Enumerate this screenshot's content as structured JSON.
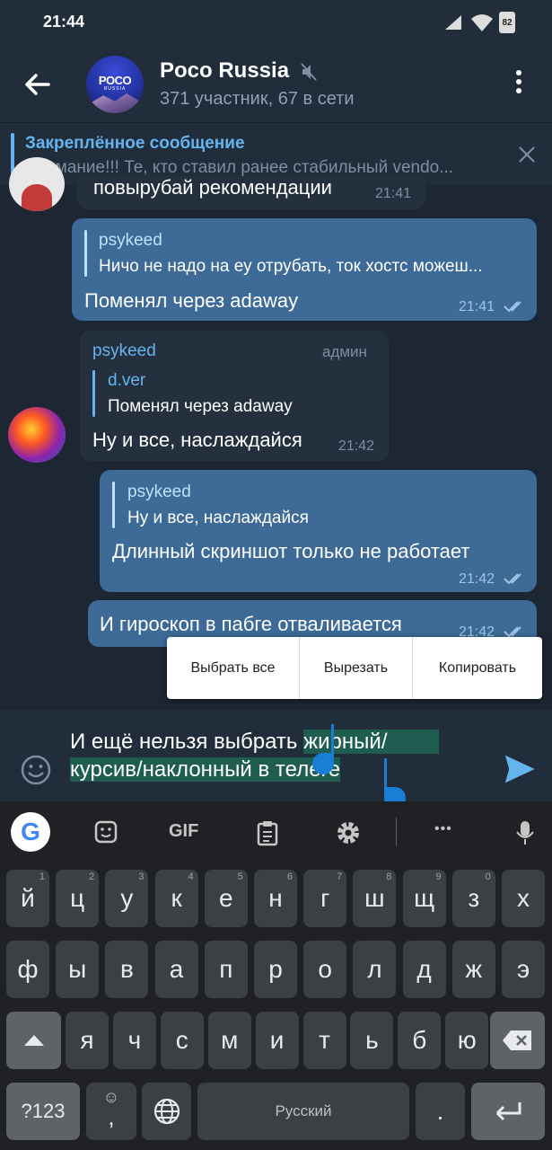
{
  "status": {
    "time": "21:44",
    "battery": "82"
  },
  "header": {
    "title": "Poco Russia",
    "subtitle": "371 участник, 67 в сети",
    "avatar_logo": "POCO",
    "avatar_sub": "RUSSIA"
  },
  "pinned": {
    "title": "Закреплённое сообщение",
    "text": "Внимание!!! Те, кто ставил ранее стабильный vendo..."
  },
  "messages": [
    {
      "text": "повырубай рекомендации",
      "time": "21:41"
    },
    {
      "reply_name": "psykeed",
      "reply_text": "Ничо не надо на еу отрубать, ток хостс можеш...",
      "text": "Поменял через adaway",
      "time": "21:41"
    },
    {
      "sender": "psykeed",
      "badge": "админ",
      "reply_name": "d.ver",
      "reply_text": "Поменял через adaway",
      "text": "Ну и все, наслаждайся",
      "time": "21:42"
    },
    {
      "reply_name": "psykeed",
      "reply_text": "Ну и все, наслаждайся",
      "text": "Длинный скриншот только не работает",
      "time": "21:42"
    },
    {
      "text": "И гироскоп в пабге отваливается",
      "time": "21:42"
    }
  ],
  "context_menu": {
    "select_all": "Выбрать все",
    "cut": "Вырезать",
    "copy": "Копировать"
  },
  "input": {
    "line1_plain": "И ещё нельзя выбрать ",
    "line1_selected": "жирный/",
    "line2_selected": "курсив/наклонный в телеге"
  },
  "keyboard": {
    "row1": [
      "й",
      "ц",
      "у",
      "к",
      "е",
      "н",
      "г",
      "ш",
      "щ",
      "з",
      "х"
    ],
    "row1_hints": [
      "1",
      "2",
      "3",
      "4",
      "5",
      "6",
      "7",
      "8",
      "9",
      "0",
      ""
    ],
    "row2": [
      "ф",
      "ы",
      "в",
      "а",
      "п",
      "р",
      "о",
      "л",
      "д",
      "ж",
      "э"
    ],
    "row3": [
      "я",
      "ч",
      "с",
      "м",
      "и",
      "т",
      "ь",
      "б",
      "ю"
    ],
    "sym_label": "?123",
    "emoji_label": "☺",
    "comma": ",",
    "space_label": "Русский",
    "period": ".",
    "toolbar_gif": "GIF",
    "toolbar_more": "•••"
  },
  "colors": {
    "accent": "#64b5ef",
    "out_bubble": "#3d6a97",
    "in_bubble": "#24303e",
    "bg": "#1d2733"
  }
}
